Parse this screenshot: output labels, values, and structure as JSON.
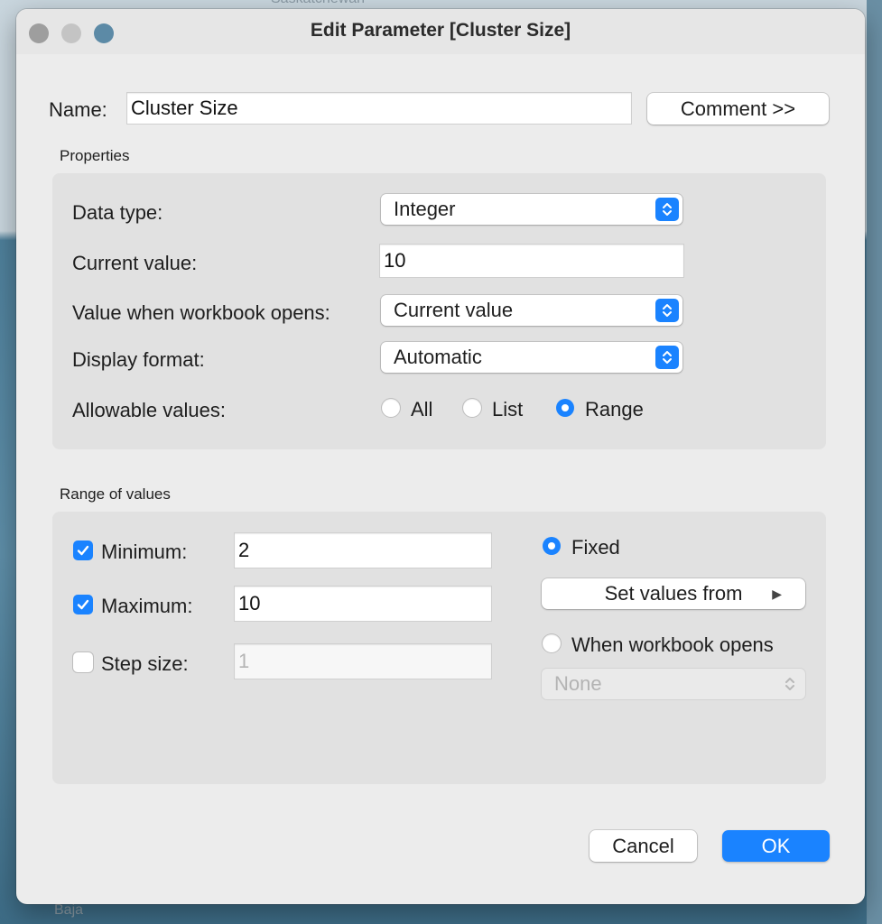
{
  "background": {
    "map_labels": [
      "Saskatchewan",
      "Baja"
    ]
  },
  "dialog": {
    "title": "Edit Parameter [Cluster Size]",
    "name_label": "Name:",
    "name_value": "Cluster Size",
    "comment_button": "Comment >>",
    "properties": {
      "heading": "Properties",
      "data_type_label": "Data type:",
      "data_type_value": "Integer",
      "current_value_label": "Current value:",
      "current_value": "10",
      "when_opens_label": "Value when workbook opens:",
      "when_opens_value": "Current value",
      "display_format_label": "Display format:",
      "display_format_value": "Automatic",
      "allowable_label": "Allowable values:",
      "allowable_options": [
        "All",
        "List",
        "Range"
      ],
      "allowable_selected": "Range"
    },
    "range": {
      "heading": "Range of values",
      "minimum_label": "Minimum:",
      "minimum_checked": true,
      "minimum_value": "2",
      "maximum_label": "Maximum:",
      "maximum_checked": true,
      "maximum_value": "10",
      "step_label": "Step size:",
      "step_checked": false,
      "step_placeholder": "1",
      "fixed_label": "Fixed",
      "fixed_selected": true,
      "set_values_button": "Set values from",
      "set_values_arrow": "▶",
      "when_opens_label": "When workbook opens",
      "when_opens_selected": false,
      "when_opens_select_value": "None"
    },
    "cancel_button": "Cancel",
    "ok_button": "OK"
  },
  "colors": {
    "accent": "#1a83ff",
    "window_bg": "#ececec",
    "panel_bg": "#e1e1e1"
  }
}
